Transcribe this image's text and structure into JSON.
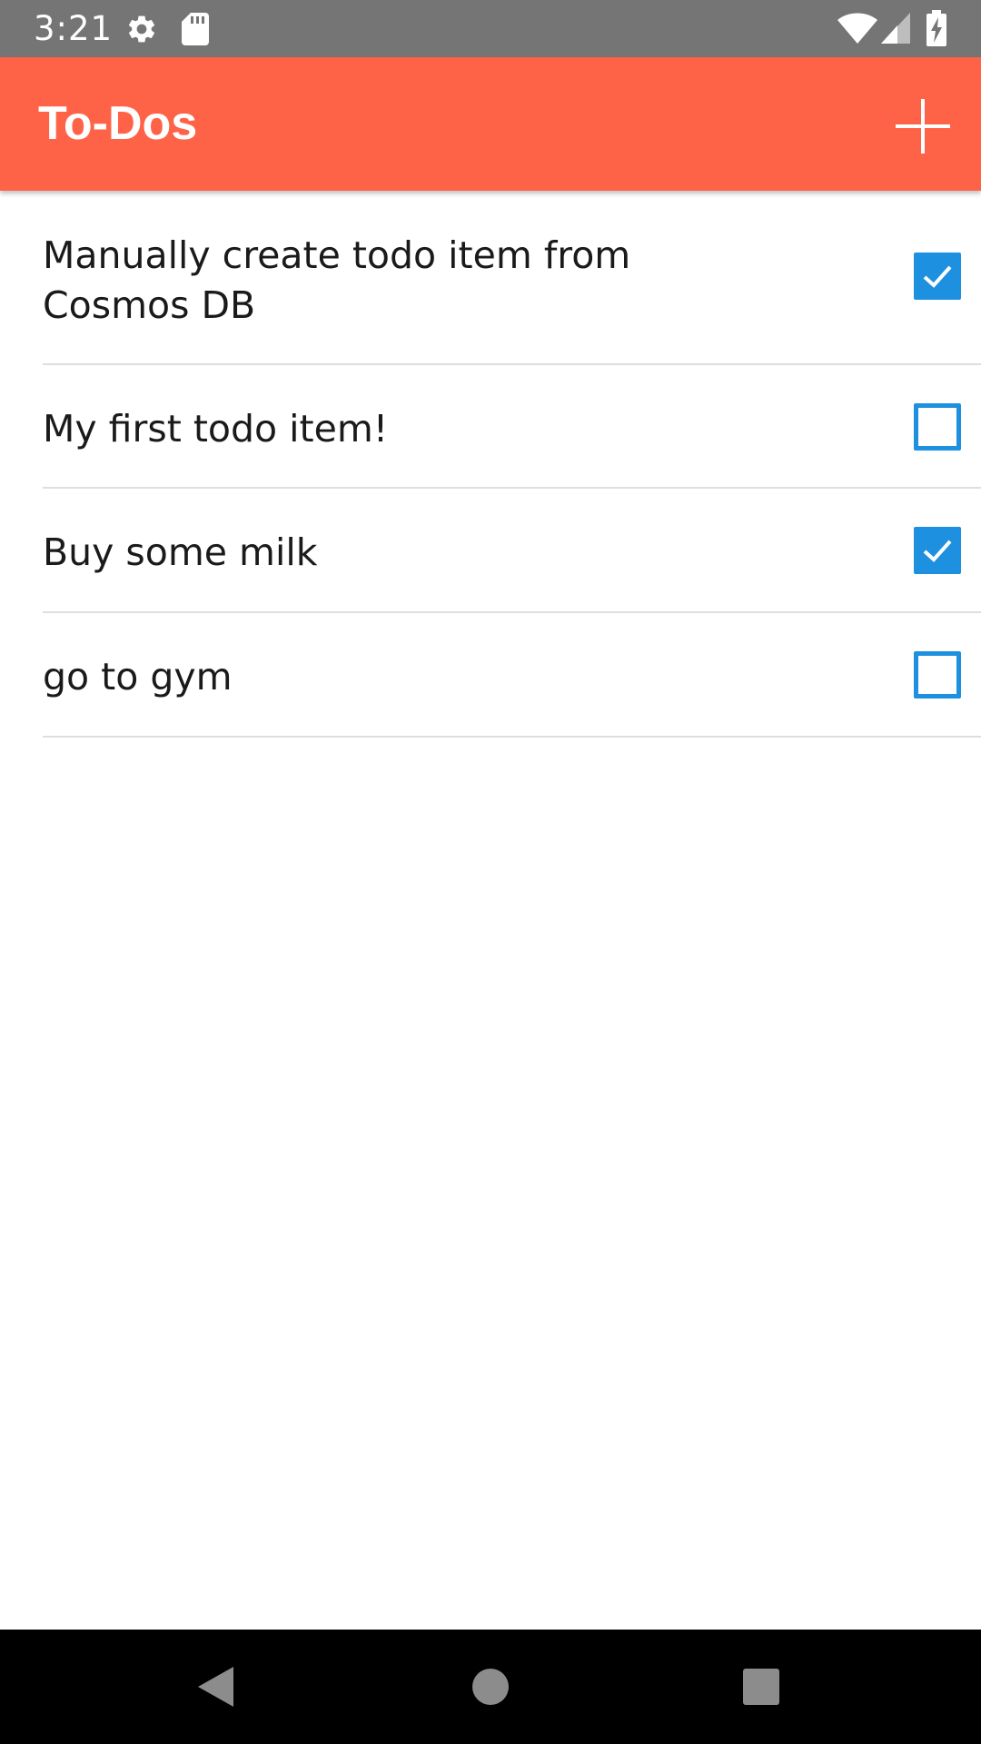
{
  "status_bar": {
    "time": "3:21",
    "icons": [
      "gear-icon",
      "sd-card-icon",
      "wifi-icon",
      "cell-signal-icon",
      "battery-charging-icon"
    ]
  },
  "app_bar": {
    "title": "To-Dos",
    "add_icon": "plus-icon",
    "color": "#ff6347"
  },
  "todos": [
    {
      "text": "Manually create todo item from Cosmos DB",
      "done": true
    },
    {
      "text": "My first todo item!",
      "done": false
    },
    {
      "text": "Buy some milk",
      "done": true
    },
    {
      "text": "go to gym",
      "done": false
    }
  ],
  "colors": {
    "checkbox": "#1e90e0",
    "status_bar": "#757575",
    "nav_bar": "#000000"
  },
  "nav_bar": {
    "buttons": [
      "back-icon",
      "home-icon",
      "recents-icon"
    ]
  }
}
